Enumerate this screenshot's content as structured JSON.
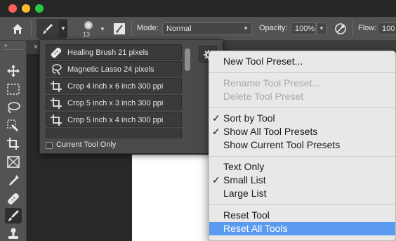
{
  "window": {
    "traffic_lights": [
      "close",
      "minimize",
      "zoom"
    ]
  },
  "options_bar": {
    "brush_size": "13",
    "mode_label": "Mode:",
    "mode_value": "Normal",
    "opacity_label": "Opacity:",
    "opacity_value": "100%",
    "flow_label": "Flow:",
    "flow_value": "100"
  },
  "toolbar": {
    "tools": [
      "move-tool",
      "marquee-tool",
      "lasso-tool",
      "quick-select-tool",
      "crop-tool",
      "frame-tool",
      "eyedropper-tool",
      "healing-brush-tool",
      "brush-tool",
      "clone-stamp-tool"
    ],
    "active": "brush-tool"
  },
  "presets_panel": {
    "items": [
      {
        "label": "Healing Brush 21 pixels",
        "icon": "healing-brush-icon"
      },
      {
        "label": "Magnetic Lasso 24 pixels",
        "icon": "magnetic-lasso-icon"
      },
      {
        "label": "Crop 4 inch x 6 inch 300 ppi",
        "icon": "crop-icon"
      },
      {
        "label": "Crop 5 inch x 3 inch 300 ppi",
        "icon": "crop-icon"
      },
      {
        "label": "Crop 5 inch x 4 inch 300 ppi",
        "icon": "crop-icon"
      }
    ],
    "current_tool_only_label": "Current Tool Only",
    "current_tool_only_checked": false
  },
  "context_menu": {
    "new_tool_preset": "New Tool Preset...",
    "rename_tool_preset": "Rename Tool Preset...",
    "delete_tool_preset": "Delete Tool Preset",
    "sort_by_tool": "Sort by Tool",
    "show_all_tool_presets": "Show All Tool Presets",
    "show_current_tool_presets": "Show Current Tool Presets",
    "text_only": "Text Only",
    "small_list": "Small List",
    "large_list": "Large List",
    "reset_tool": "Reset Tool",
    "reset_all_tools": "Reset All Tools",
    "checkmark": "✓",
    "highlighted": "reset_all_tools"
  },
  "colors": {
    "menu_highlight": "#5b9bef",
    "panel_bg": "#4a4a4a",
    "ui_bg": "#535353"
  }
}
